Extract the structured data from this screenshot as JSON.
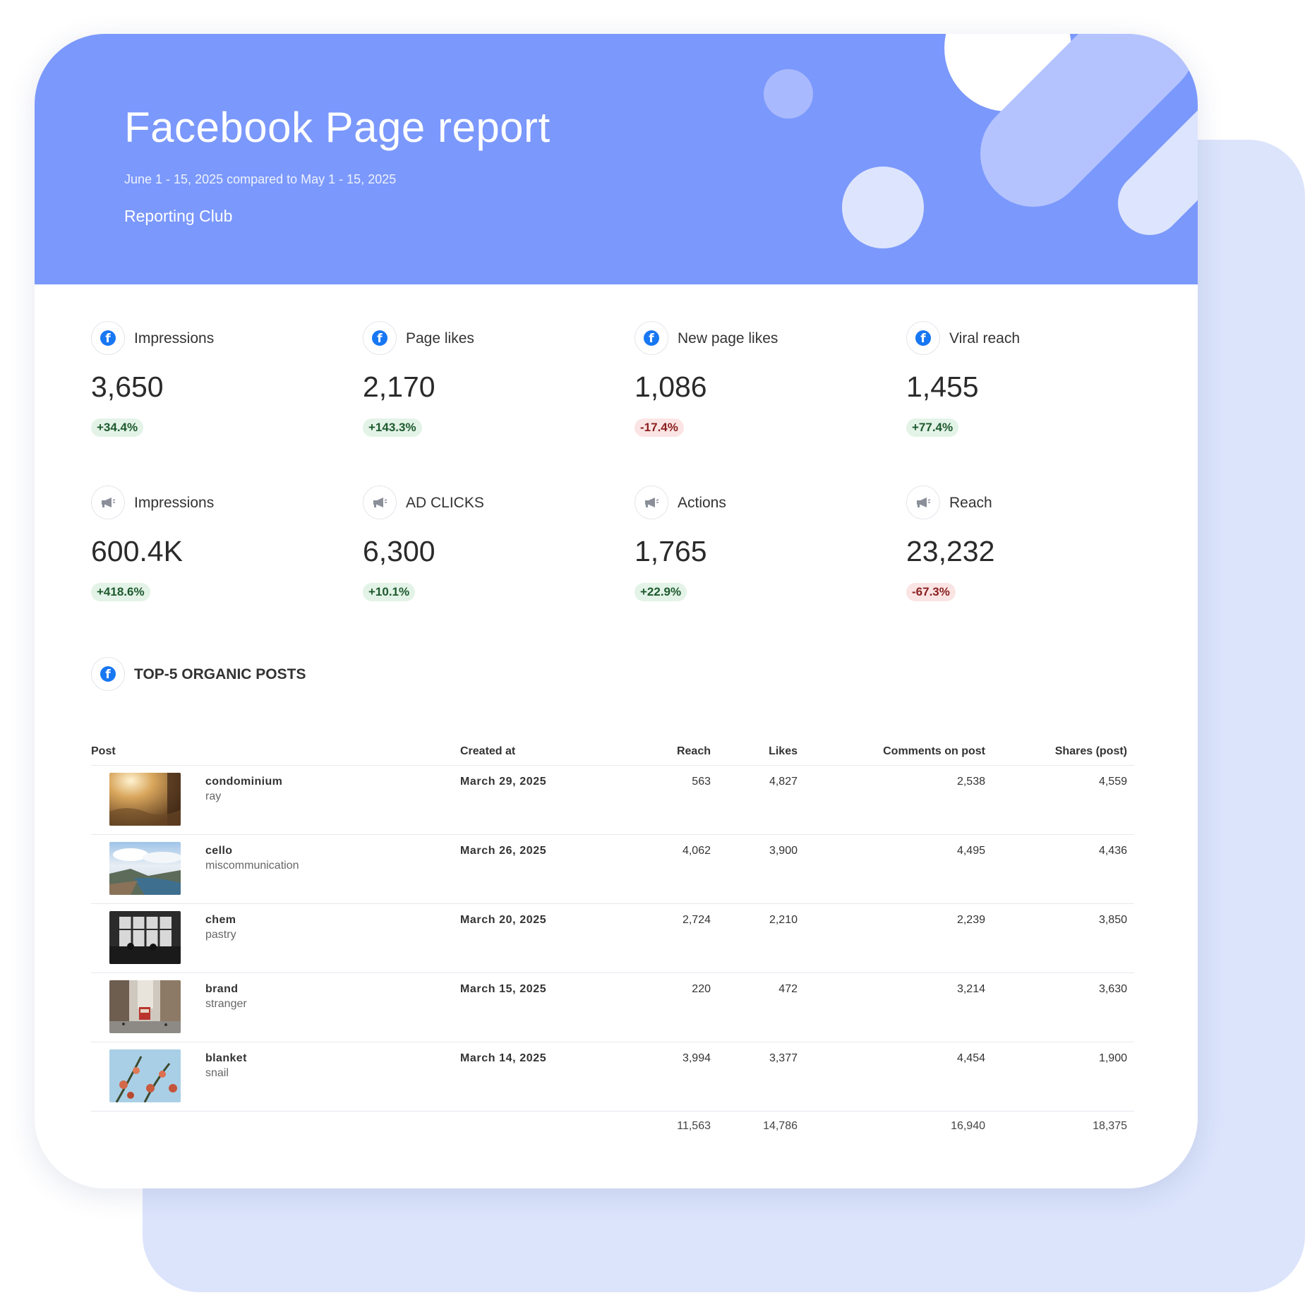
{
  "header": {
    "title": "Facebook Page report",
    "subtitle": "June 1 - 15, 2025 compared to May 1 - 15, 2025",
    "organization": "Reporting Club"
  },
  "colors": {
    "hero": "#7b98fc",
    "back_card": "#dbe4fb",
    "positive_bg": "#e3f3e7",
    "negative_bg": "#fbe4e4",
    "facebook_blue": "#1877f2"
  },
  "metrics": [
    {
      "icon": "facebook-icon",
      "label": "Impressions",
      "value": "3,650",
      "change": "+34.4%",
      "trend": "up"
    },
    {
      "icon": "facebook-icon",
      "label": "Page likes",
      "value": "2,170",
      "change": "+143.3%",
      "trend": "up"
    },
    {
      "icon": "facebook-icon",
      "label": "New page likes",
      "value": "1,086",
      "change": "-17.4%",
      "trend": "down"
    },
    {
      "icon": "facebook-icon",
      "label": "Viral reach",
      "value": "1,455",
      "change": "+77.4%",
      "trend": "up"
    },
    {
      "icon": "megaphone-icon",
      "label": "Impressions",
      "value": "600.4K",
      "change": "+418.6%",
      "trend": "up"
    },
    {
      "icon": "megaphone-icon",
      "label": "AD CLICKS",
      "value": "6,300",
      "change": "+10.1%",
      "trend": "up"
    },
    {
      "icon": "megaphone-icon",
      "label": "Actions",
      "value": "1,765",
      "change": "+22.9%",
      "trend": "up"
    },
    {
      "icon": "megaphone-icon",
      "label": "Reach",
      "value": "23,232",
      "change": "-67.3%",
      "trend": "down"
    }
  ],
  "posts_section": {
    "icon": "facebook-icon",
    "title": "TOP-5 ORGANIC POSTS",
    "columns": {
      "post": "Post",
      "created": "Created at",
      "reach": "Reach",
      "likes": "Likes",
      "comments": "Comments on post",
      "shares": "Shares (post)"
    },
    "rows": [
      {
        "title": "condominium",
        "subtitle": "ray",
        "created": "March 29, 2025",
        "reach": "563",
        "likes": "4,827",
        "comments": "2,538",
        "shares": "4,559",
        "thumb": "sunlit-field"
      },
      {
        "title": "cello",
        "subtitle": "miscommunication",
        "created": "March 26, 2025",
        "reach": "4,062",
        "likes": "3,900",
        "comments": "4,495",
        "shares": "4,436",
        "thumb": "fjord-landscape"
      },
      {
        "title": "chem",
        "subtitle": "pastry",
        "created": "March 20, 2025",
        "reach": "2,724",
        "likes": "2,210",
        "comments": "2,239",
        "shares": "3,850",
        "thumb": "cafe-window-bw"
      },
      {
        "title": "brand",
        "subtitle": "stranger",
        "created": "March 15, 2025",
        "reach": "220",
        "likes": "472",
        "comments": "3,214",
        "shares": "3,630",
        "thumb": "city-street-tram"
      },
      {
        "title": "blanket",
        "subtitle": "snail",
        "created": "March 14, 2025",
        "reach": "3,994",
        "likes": "3,377",
        "comments": "4,454",
        "shares": "1,900",
        "thumb": "flowers-sky"
      }
    ],
    "totals": {
      "reach": "11,563",
      "likes": "14,786",
      "comments": "16,940",
      "shares": "18,375"
    }
  }
}
